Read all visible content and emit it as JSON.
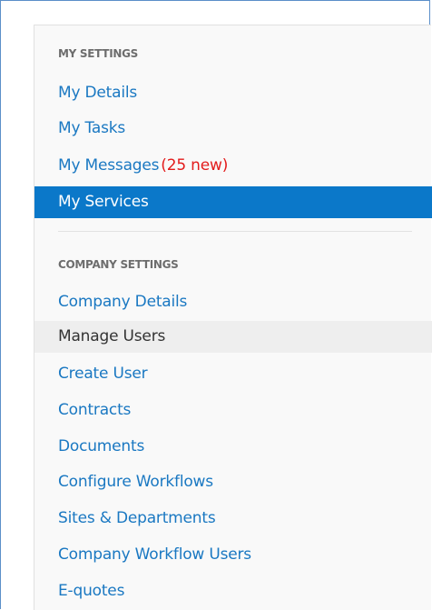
{
  "my_settings": {
    "heading": "MY SETTINGS",
    "items": [
      {
        "label": "My Details"
      },
      {
        "label": "My Tasks"
      },
      {
        "label": "My Messages",
        "badge": "(25 new)"
      },
      {
        "label": "My Services"
      }
    ]
  },
  "company_settings": {
    "heading": "COMPANY SETTINGS",
    "items": [
      {
        "label": "Company Details"
      },
      {
        "label": "Manage Users"
      },
      {
        "label": "Create User"
      },
      {
        "label": "Contracts"
      },
      {
        "label": "Documents"
      },
      {
        "label": "Configure Workflows"
      },
      {
        "label": "Sites & Departments"
      },
      {
        "label": "Company Workflow Users"
      },
      {
        "label": "E-quotes"
      }
    ]
  },
  "colors": {
    "link": "#1a78c2",
    "active_background": "#0b78c9",
    "badge": "#e31b1b",
    "heading": "#6d6d6d"
  }
}
